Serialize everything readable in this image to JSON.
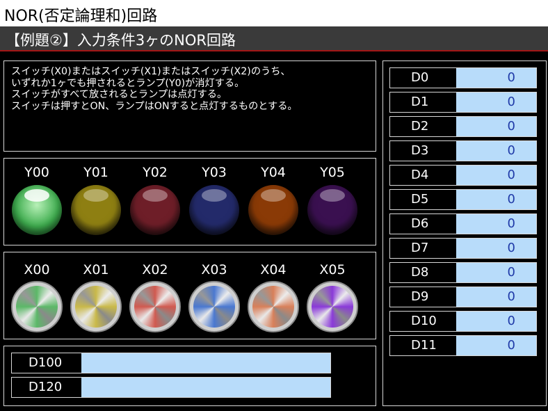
{
  "title": "NOR(否定論理和)回路",
  "subtitle": "【例題②】入力条件3ヶのNOR回路",
  "description": "スイッチ(X0)またはスイッチ(X1)またはスイッチ(X2)のうち、\nいずれか1ヶでも押されるとランプ(Y0)が消灯する。\nスイッチがすべて放されるとランプは点灯する。\nスイッチは押すとON、ランプはONすると点灯するものとする。",
  "lamps": [
    {
      "label": "Y00",
      "state": "on",
      "color": "#3fae4f"
    },
    {
      "label": "Y01",
      "state": "off",
      "color": "#8e7f12"
    },
    {
      "label": "Y02",
      "state": "off",
      "color": "#6e1e28"
    },
    {
      "label": "Y03",
      "state": "off",
      "color": "#232a6a"
    },
    {
      "label": "Y04",
      "state": "off",
      "color": "#8a3a06"
    },
    {
      "label": "Y05",
      "state": "off",
      "color": "#3a1050"
    }
  ],
  "switches": [
    {
      "label": "X00",
      "color": "#5cb868"
    },
    {
      "label": "X01",
      "color": "#c9b94a"
    },
    {
      "label": "X02",
      "color": "#d05a50"
    },
    {
      "label": "X03",
      "color": "#4a78d0"
    },
    {
      "label": "X04",
      "color": "#d8805a"
    },
    {
      "label": "X05",
      "color": "#8a3ad8"
    }
  ],
  "registers": [
    {
      "name": "D100",
      "value": ""
    },
    {
      "name": "D120",
      "value": ""
    }
  ],
  "data_registers": [
    {
      "name": "D0",
      "value": "0"
    },
    {
      "name": "D1",
      "value": "0"
    },
    {
      "name": "D2",
      "value": "0"
    },
    {
      "name": "D3",
      "value": "0"
    },
    {
      "name": "D4",
      "value": "0"
    },
    {
      "name": "D5",
      "value": "0"
    },
    {
      "name": "D6",
      "value": "0"
    },
    {
      "name": "D7",
      "value": "0"
    },
    {
      "name": "D8",
      "value": "0"
    },
    {
      "name": "D9",
      "value": "0"
    },
    {
      "name": "D10",
      "value": "0"
    },
    {
      "name": "D11",
      "value": "0"
    }
  ]
}
